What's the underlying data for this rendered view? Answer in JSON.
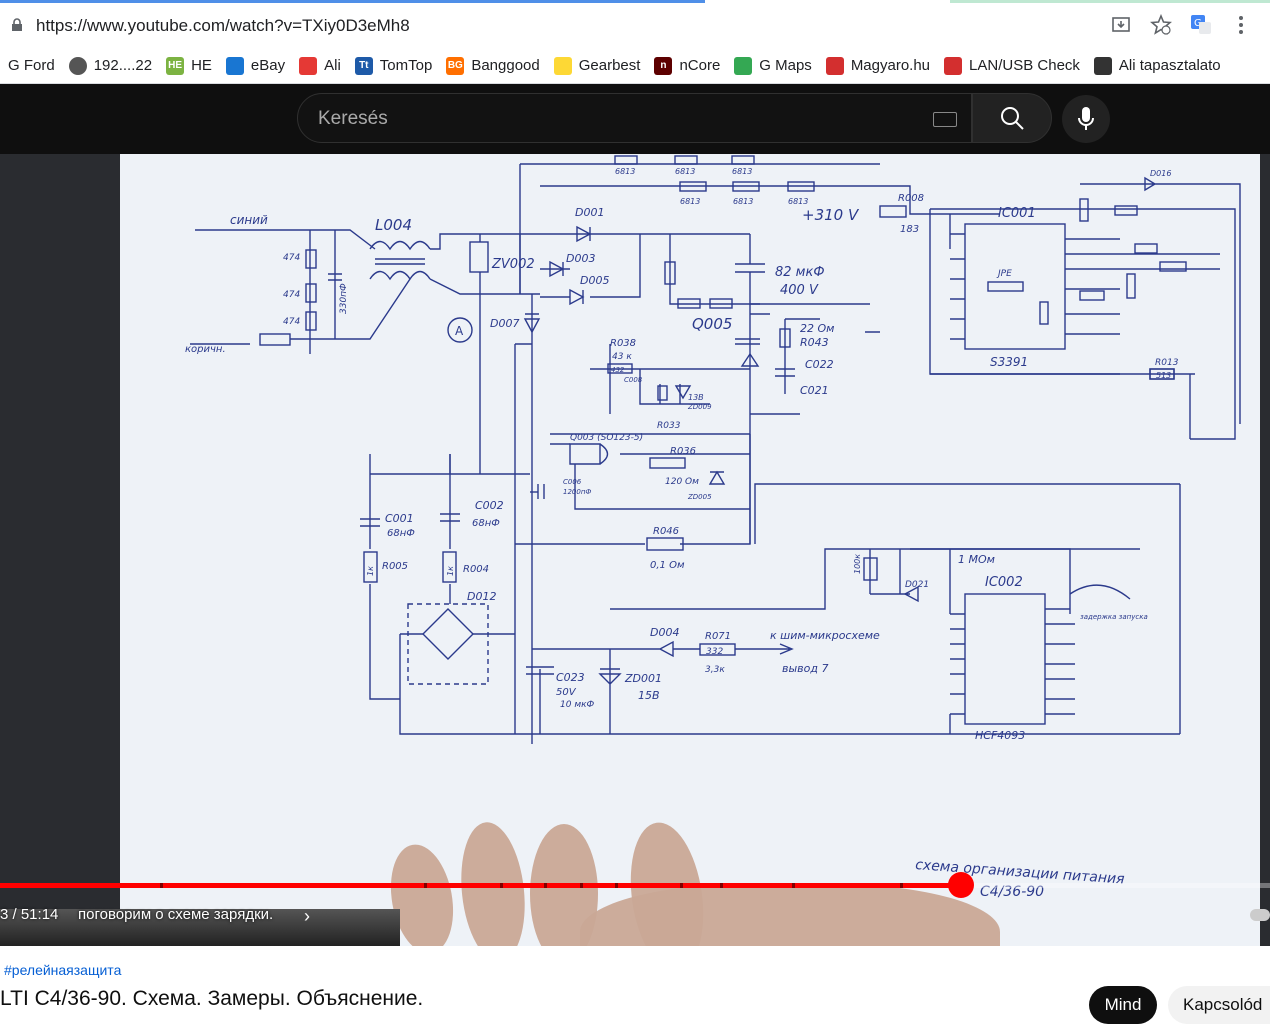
{
  "browser": {
    "url": "https://www.youtube.com/watch?v=TXiy0D3eMh8",
    "bookmarks": [
      {
        "label": "G Ford",
        "icon": "none",
        "color": "#ffffff"
      },
      {
        "label": "192....22",
        "icon": "globe-icon",
        "color": "#555555"
      },
      {
        "label": "HE",
        "icon": "HE",
        "color": "#7cb342"
      },
      {
        "label": "eBay",
        "icon": "shopping-bag-icon",
        "color": "#1976d2"
      },
      {
        "label": "Ali",
        "icon": "ali-icon",
        "color": "#e53935"
      },
      {
        "label": "TomTop",
        "icon": "Tt",
        "color": "#1e5aa8"
      },
      {
        "label": "Banggood",
        "icon": "BG",
        "color": "#ff6f00"
      },
      {
        "label": "Gearbest",
        "icon": "gearbest-icon",
        "color": "#fdd835"
      },
      {
        "label": "nCore",
        "icon": "n",
        "color": "#5d0000"
      },
      {
        "label": "G Maps",
        "icon": "map-pin-icon",
        "color": "#34a853"
      },
      {
        "label": "Magyaro.hu",
        "icon": "magyaro-icon",
        "color": "#d32f2f"
      },
      {
        "label": "LAN/USB Check",
        "icon": "lan-icon",
        "color": "#d32f2f"
      },
      {
        "label": "Ali tapasztalato",
        "icon": "ali-exp-icon",
        "color": "#333333"
      }
    ]
  },
  "youtube": {
    "search_placeholder": "Keresés",
    "player": {
      "time": "3 / 51:14",
      "chapter": "поговорим о схеме зарядки.",
      "progress_fraction": 0.757
    },
    "hashtag": "#релейнаязащита",
    "video_title": "LTI C4/36-90. Схема. Замеры. Объяснение.",
    "buttons": {
      "subscribe": "Mind",
      "related": "Kapcsolód"
    }
  },
  "schematic": {
    "labels": {
      "wire_blue": "синий",
      "wire_brown": "коричн.",
      "l004": "L004",
      "r474a": "474",
      "r474b": "474",
      "r474c": "474",
      "c330": "330пФ",
      "zv002": "ZV002",
      "d001": "D001",
      "d003": "D003",
      "d005": "D005",
      "d007": "D007",
      "ammeter": "A",
      "v310": "+310 V",
      "c82": "82 мкФ",
      "c400": "400 V",
      "r6813a": "6813",
      "r6813b": "6813",
      "r6813c": "6813",
      "r6813d": "6813",
      "r6813e": "6813",
      "r6813f": "6813",
      "r008": "R008",
      "r183": "183",
      "ic001": "IC001",
      "ic001_part": "S3391",
      "q005": "Q005",
      "r22": "22 Ом",
      "r043": "R043",
      "c022": "C022",
      "c021": "C021",
      "r038": "R038",
      "r43k": "43 к",
      "r432": "432",
      "c008": "C008",
      "d13": "13В",
      "zd009": "ZD009",
      "r033": "R033",
      "q003": "Q003 (SO123-5)",
      "r036": "R036",
      "r120": "120 Ом",
      "zd005": "ZD005",
      "c006": "C006",
      "c1200": "1200пФ",
      "c001": "C001",
      "c68a": "68нФ",
      "c002": "C002",
      "c68b": "68нФ",
      "r005": "R005",
      "r004": "R004",
      "r1ka": "1к",
      "r1kb": "1к",
      "r046": "R046",
      "r01": "0,1 Ом",
      "d012": "D012",
      "c023": "C023",
      "c50v": "50V",
      "c10": "10 мкФ",
      "zd001": "ZD001",
      "z15": "15В",
      "d004": "D004",
      "r071": "R071",
      "r332": "332",
      "r33k": "3,3к",
      "to_pwm": "к шим-микросхеме",
      "pin7": "вывод 7",
      "ic002": "IC002",
      "ic002_part": "HCF4093",
      "r100k": "100к",
      "r1m": "1 МОм",
      "d021": "D021",
      "start_delay": "задержка запуска",
      "r013": "R013",
      "r513": "513",
      "d016": "D016",
      "jpe": "JPE",
      "caption": "схема организации питания",
      "caption2": "C4/36-90"
    }
  },
  "colors": {
    "accent_red": "#ff0000",
    "yt_dark": "#0f0f0f",
    "ink": "#2b3a8c"
  }
}
